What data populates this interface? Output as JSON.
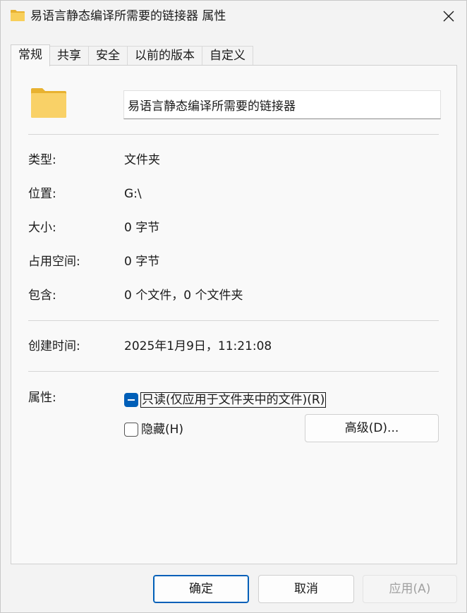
{
  "window": {
    "title": "易语言静态编译所需要的链接器 属性"
  },
  "tabs": [
    {
      "label": "常规",
      "active": true
    },
    {
      "label": "共享",
      "active": false
    },
    {
      "label": "安全",
      "active": false
    },
    {
      "label": "以前的版本",
      "active": false
    },
    {
      "label": "自定义",
      "active": false
    }
  ],
  "general": {
    "folder_name": "易语言静态编译所需要的链接器",
    "rows": [
      {
        "label": "类型:",
        "value": "文件夹"
      },
      {
        "label": "位置:",
        "value": "G:\\"
      },
      {
        "label": "大小:",
        "value": "0 字节"
      },
      {
        "label": "占用空间:",
        "value": "0 字节"
      },
      {
        "label": "包含:",
        "value": "0 个文件，0 个文件夹"
      }
    ],
    "created": {
      "label": "创建时间:",
      "value": "2025年1月9日，11:21:08"
    },
    "attributes": {
      "label": "属性:",
      "readonly_label": "只读(仅应用于文件夹中的文件)(R)",
      "hidden_label": "隐藏(H)",
      "advanced_label": "高级(D)..."
    }
  },
  "footer": {
    "ok_label": "确定",
    "cancel_label": "取消",
    "apply_label": "应用(A)"
  },
  "colors": {
    "accent": "#005fb8",
    "folder": "#f5c542"
  }
}
